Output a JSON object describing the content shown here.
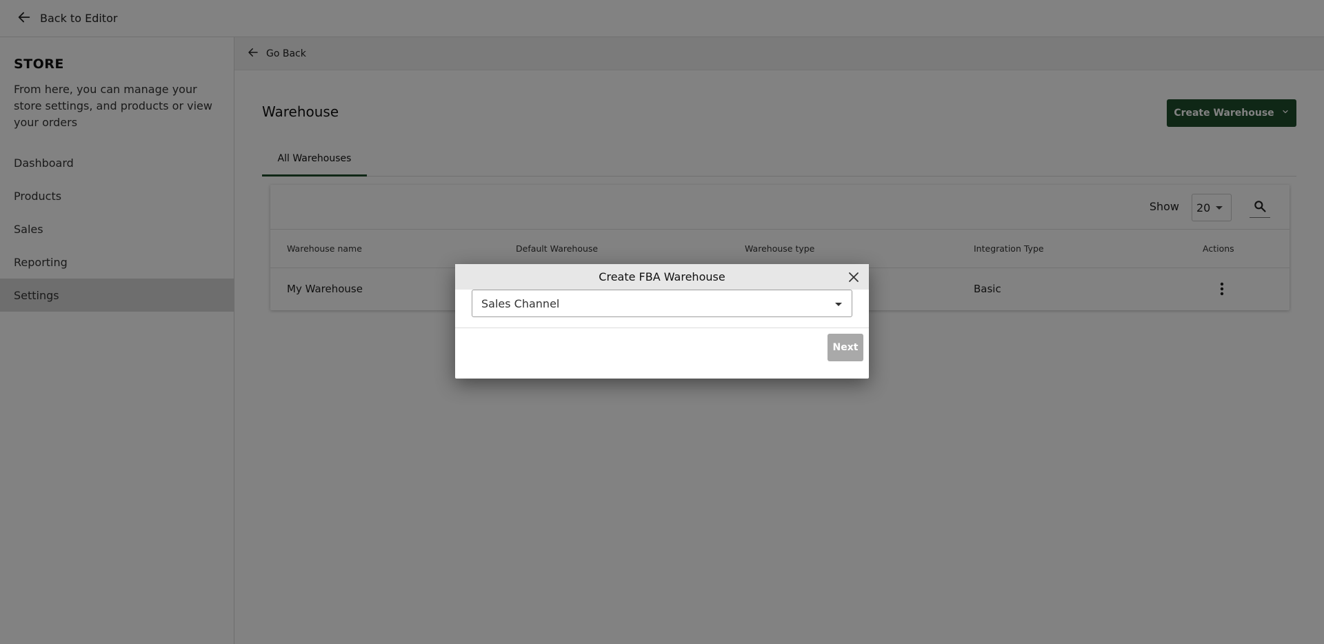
{
  "topbar": {
    "back_label": "Back to Editor"
  },
  "sidebar": {
    "title": "STORE",
    "description": "From here, you can manage your store settings, and products or view your orders",
    "items": [
      {
        "label": "Dashboard",
        "active": false
      },
      {
        "label": "Products",
        "active": false
      },
      {
        "label": "Sales",
        "active": false
      },
      {
        "label": "Reporting",
        "active": false
      },
      {
        "label": "Settings",
        "active": true
      }
    ]
  },
  "main": {
    "go_back_label": "Go Back",
    "page_title": "Warehouse",
    "create_button_label": "Create Warehouse",
    "tabs": [
      {
        "label": "All Warehouses",
        "active": true
      }
    ],
    "show_label": "Show",
    "show_value": "20",
    "table": {
      "columns": [
        "Warehouse name",
        "Default Warehouse",
        "Warehouse type",
        "Integration Type",
        "Actions"
      ],
      "rows": [
        {
          "name": "My Warehouse",
          "default": "",
          "type": "",
          "integration": "Basic"
        }
      ]
    }
  },
  "modal": {
    "title": "Create FBA Warehouse",
    "select_placeholder": "Sales Channel",
    "next_label": "Next"
  },
  "colors": {
    "accent": "#1e4d2b",
    "overlay": "#000000",
    "sidebar_active": "#d7d7d7",
    "next_disabled": "#a9a9a9"
  },
  "icons": {
    "back": "arrow-left-icon",
    "dropdown": "chevron-down-icon",
    "search": "search-icon",
    "actions": "more-vertical-icon",
    "close": "close-icon"
  }
}
